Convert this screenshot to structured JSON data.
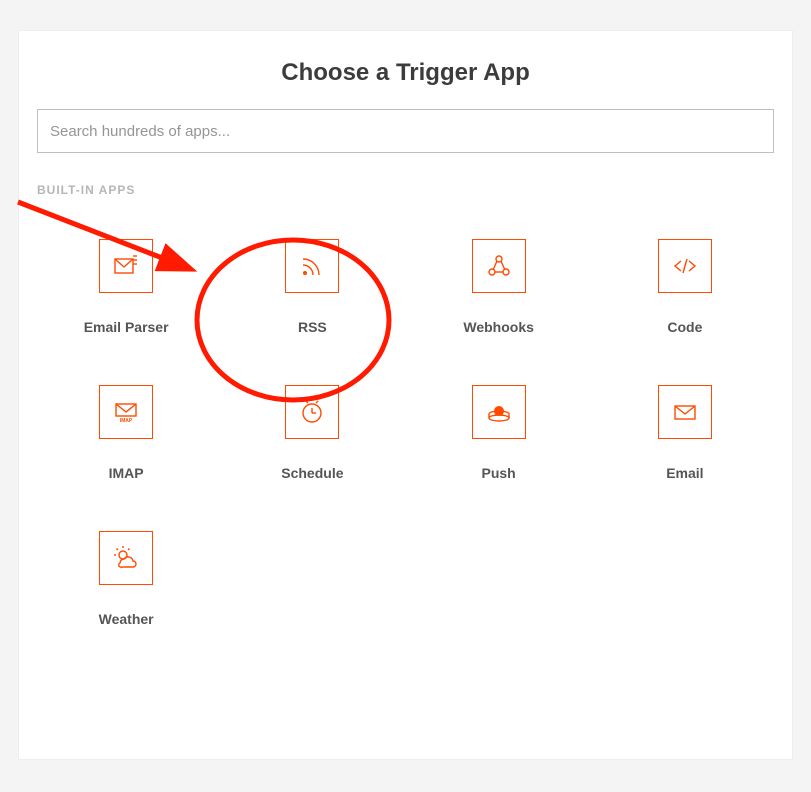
{
  "title": "Choose a Trigger App",
  "search": {
    "placeholder": "Search hundreds of apps..."
  },
  "sections": {
    "builtin": {
      "label": "BUILT-IN APPS",
      "apps": [
        {
          "label": "Email Parser",
          "icon": "email-parser"
        },
        {
          "label": "RSS",
          "icon": "rss"
        },
        {
          "label": "Webhooks",
          "icon": "webhooks"
        },
        {
          "label": "Code",
          "icon": "code"
        },
        {
          "label": "IMAP",
          "icon": "imap"
        },
        {
          "label": "Schedule",
          "icon": "schedule"
        },
        {
          "label": "Push",
          "icon": "push"
        },
        {
          "label": "Email",
          "icon": "email"
        },
        {
          "label": "Weather",
          "icon": "weather"
        }
      ]
    }
  },
  "annotation": {
    "highlight_app_index": 1,
    "colors": {
      "accent": "#ff4a00",
      "annotation": "#ff1a00"
    }
  }
}
